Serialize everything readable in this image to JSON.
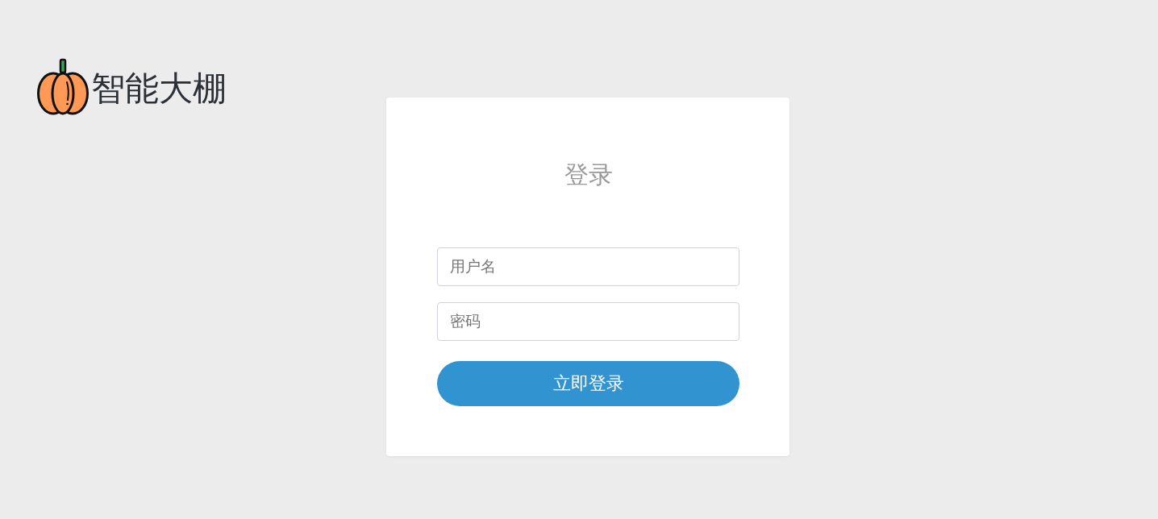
{
  "logo": {
    "text": "智能大棚"
  },
  "login_card": {
    "title": "登录",
    "fields": [
      {
        "placeholder": "用户名"
      },
      {
        "placeholder": "密码"
      }
    ],
    "submit_button": "立即登录"
  }
}
